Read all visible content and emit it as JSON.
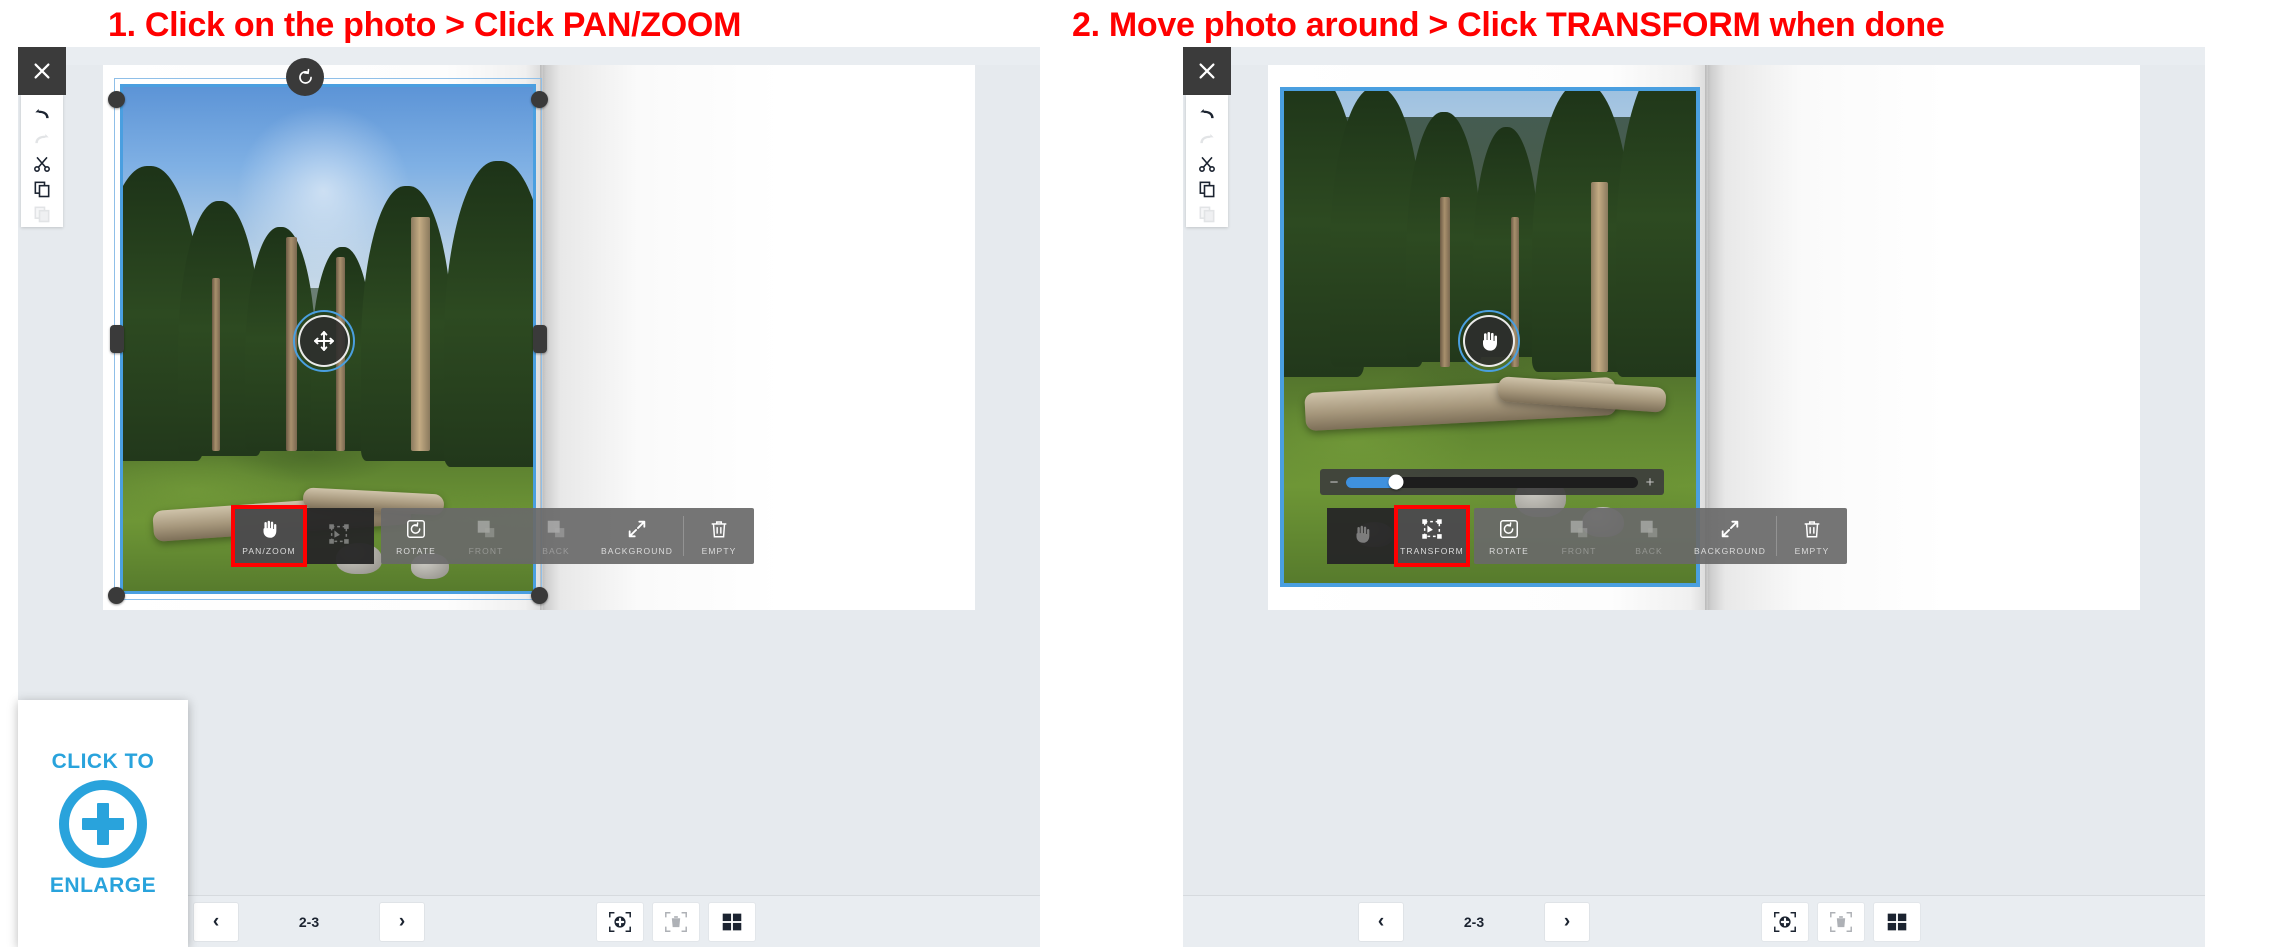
{
  "headings": {
    "step1": "1. Click on the photo > Click PAN/ZOOM",
    "step2": "2. Move photo around > Click TRANSFORM when done"
  },
  "colors": {
    "annotation_red": "#ff0000",
    "selection_blue": "#4a9fe0",
    "accent_blue": "#29a3dc",
    "slider_blue": "#3f91dd",
    "toolbar_dark": "#262626",
    "toolbar_grey": "#696969"
  },
  "side_rail": {
    "close_label": "Close",
    "items": [
      {
        "name": "undo",
        "label": "Undo",
        "disabled": false
      },
      {
        "name": "redo",
        "label": "Redo",
        "disabled": true
      },
      {
        "name": "cut",
        "label": "Cut",
        "disabled": false
      },
      {
        "name": "copy",
        "label": "Copy",
        "disabled": false
      },
      {
        "name": "paste",
        "label": "Paste",
        "disabled": true
      }
    ]
  },
  "left_panel": {
    "mode": "transform",
    "center_handle_icon": "move-arrows-icon",
    "selection_visible": true,
    "rotate_handle_visible": true,
    "zoom_slider_visible": false,
    "toolbar": {
      "highlighted": "PAN/ZOOM",
      "buttons": [
        {
          "label": "PAN/ZOOM",
          "icon": "hand-icon",
          "state": "active",
          "group": "dark"
        },
        {
          "label": "",
          "icon": "transform-icon",
          "state": "dim",
          "group": "dark"
        },
        {
          "label": "ROTATE",
          "icon": "rotate-icon",
          "state": "normal",
          "group": "grey"
        },
        {
          "label": "FRONT",
          "icon": "bring-front-icon",
          "state": "dim",
          "group": "grey"
        },
        {
          "label": "BACK",
          "icon": "send-back-icon",
          "state": "dim",
          "group": "grey"
        },
        {
          "label": "BACKGROUND",
          "icon": "expand-icon",
          "state": "normal",
          "group": "grey"
        },
        {
          "label": "EMPTY",
          "icon": "trash-icon",
          "state": "normal",
          "group": "grey"
        }
      ]
    },
    "bottom": {
      "prev": "‹",
      "next": "›",
      "page_label": "2-3",
      "icons": [
        {
          "name": "add-photo-icon",
          "state": "normal"
        },
        {
          "name": "delete-photo-icon",
          "state": "dim"
        },
        {
          "name": "layout-grid-icon",
          "state": "normal"
        }
      ]
    }
  },
  "right_panel": {
    "mode": "pan",
    "center_handle_icon": "hand-icon",
    "selection_visible": false,
    "rotate_handle_visible": false,
    "zoom_slider_visible": true,
    "zoom_slider": {
      "minus": "−",
      "plus": "+",
      "value_percent": 17
    },
    "toolbar": {
      "highlighted": "TRANSFORM",
      "buttons": [
        {
          "label": "",
          "icon": "hand-icon",
          "state": "dim",
          "group": "dark"
        },
        {
          "label": "TRANSFORM",
          "icon": "transform-icon",
          "state": "active",
          "group": "dark"
        },
        {
          "label": "ROTATE",
          "icon": "rotate-icon",
          "state": "normal",
          "group": "grey"
        },
        {
          "label": "FRONT",
          "icon": "bring-front-icon",
          "state": "dim",
          "group": "grey"
        },
        {
          "label": "BACK",
          "icon": "send-back-icon",
          "state": "dim",
          "group": "grey"
        },
        {
          "label": "BACKGROUND",
          "icon": "expand-icon",
          "state": "normal",
          "group": "grey"
        },
        {
          "label": "EMPTY",
          "icon": "trash-icon",
          "state": "normal",
          "group": "grey"
        }
      ]
    },
    "bottom": {
      "prev": "‹",
      "next": "›",
      "page_label": "2-3",
      "icons": [
        {
          "name": "add-photo-icon",
          "state": "normal"
        },
        {
          "name": "delete-photo-icon",
          "state": "dim"
        },
        {
          "name": "layout-grid-icon",
          "state": "normal"
        }
      ]
    }
  },
  "enlarge_overlay": {
    "top_text": "CLICK TO",
    "bottom_text": "ENLARGE",
    "icon": "plus-circle-icon"
  }
}
